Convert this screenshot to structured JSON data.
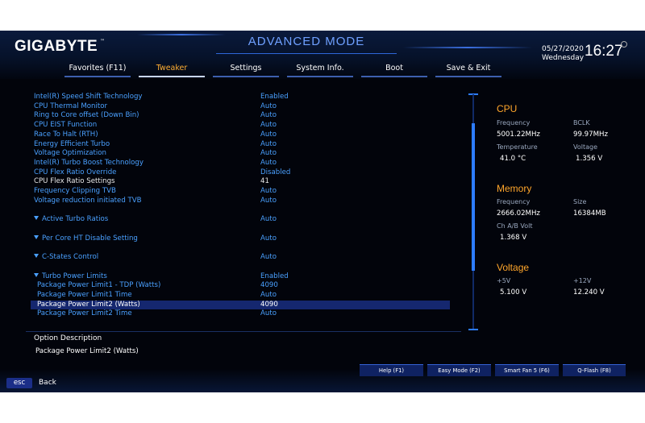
{
  "header": {
    "brand": "GIGABYTE",
    "trademark": "™",
    "mode_title": "ADVANCED MODE",
    "date": "05/27/2020",
    "weekday": "Wednesday",
    "time": "16:27"
  },
  "tabs": [
    "Favorites (F11)",
    "Tweaker",
    "Settings",
    "System Info.",
    "Boot",
    "Save & Exit"
  ],
  "active_tab": "Tweaker",
  "settings": [
    {
      "label": "Intel(R) Speed Shift Technology",
      "value": "Enabled"
    },
    {
      "label": "CPU Thermal Monitor",
      "value": "Auto"
    },
    {
      "label": "Ring to Core offset (Down Bin)",
      "value": "Auto"
    },
    {
      "label": "CPU EIST Function",
      "value": "Auto"
    },
    {
      "label": "Race To Halt (RTH)",
      "value": "Auto"
    },
    {
      "label": "Energy Efficient Turbo",
      "value": "Auto"
    },
    {
      "label": "Voltage Optimization",
      "value": "Auto"
    },
    {
      "label": "Intel(R) Turbo Boost Technology",
      "value": "Auto"
    },
    {
      "label": "CPU Flex Ratio Override",
      "value": "Disabled"
    },
    {
      "label": "CPU Flex Ratio Settings",
      "value": "41"
    },
    {
      "label": "Frequency Clipping TVB",
      "value": "Auto"
    },
    {
      "label": "Voltage reduction initiated TVB",
      "value": "Auto"
    },
    {
      "label": "Active Turbo Ratios",
      "value": "Auto"
    },
    {
      "label": "Per Core HT Disable Setting",
      "value": "Auto"
    },
    {
      "label": "C-States Control",
      "value": "Auto"
    },
    {
      "label": "Turbo Power Limits",
      "value": "Enabled"
    },
    {
      "label": "Package Power Limit1 - TDP (Watts)",
      "value": "4090"
    },
    {
      "label": "Package Power Limit1 Time",
      "value": "Auto"
    },
    {
      "label": "Package Power Limit2 (Watts)",
      "value": "4090"
    },
    {
      "label": "Package Power Limit2 Time",
      "value": "Auto"
    }
  ],
  "description": {
    "title": "Option Description",
    "text": "Package Power Limit2 (Watts)"
  },
  "cpu": {
    "heading": "CPU",
    "frequency_label": "Frequency",
    "frequency": "5001.22MHz",
    "bclk_label": "BCLK",
    "bclk": "99.97MHz",
    "temperature_label": "Temperature",
    "temperature": "41.0 °C",
    "voltage_label": "Voltage",
    "voltage": "1.356 V"
  },
  "memory": {
    "heading": "Memory",
    "frequency_label": "Frequency",
    "frequency": "2666.02MHz",
    "size_label": "Size",
    "size": "16384MB",
    "ch_ab_volt_label": "Ch A/B Volt",
    "ch_ab_volt": "1.368 V"
  },
  "voltage": {
    "heading": "Voltage",
    "v5_label": "+5V",
    "v5": "5.100 V",
    "v12_label": "+12V",
    "v12": "12.240 V"
  },
  "footer_buttons": [
    "Help (F1)",
    "Easy Mode (F2)",
    "Smart Fan 5 (F6)",
    "Q-Flash (F8)"
  ],
  "esc": {
    "key": "esc",
    "label": "Back"
  },
  "colors": {
    "accent_orange": "#ffa62b",
    "link_blue": "#4aa0ff",
    "selection": "#15276f",
    "background": "#02040b"
  }
}
